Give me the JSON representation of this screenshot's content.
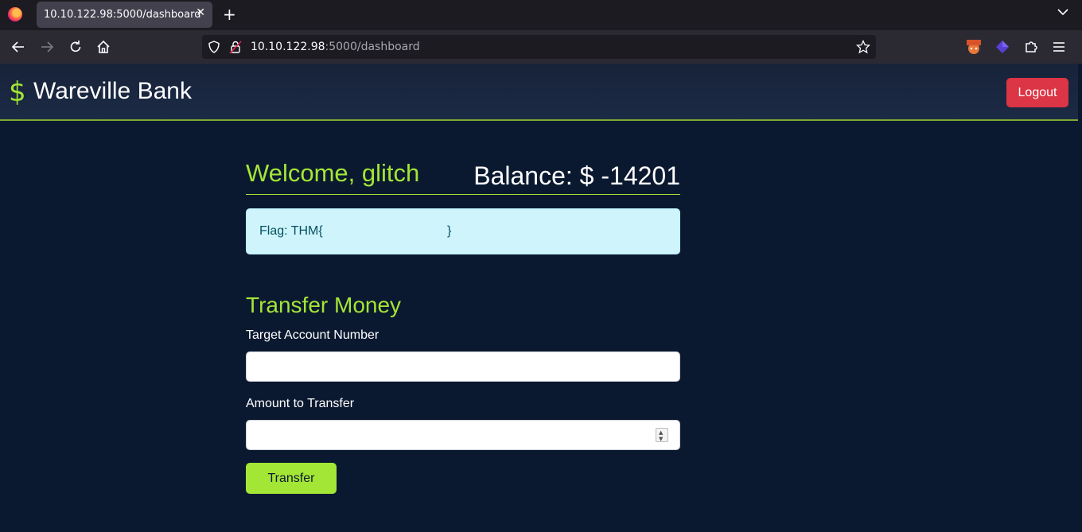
{
  "browser": {
    "tab_title": "10.10.122.98:5000/dashboard",
    "tab_close": "✕",
    "new_tab": "+",
    "url_host": "10.10.122.98",
    "url_path": ":5000/dashboard"
  },
  "header": {
    "brand_icon": "$",
    "brand_name": "Wareville Bank",
    "logout_label": "Logout"
  },
  "dashboard": {
    "welcome": "Welcome, glitch",
    "balance": "Balance: $ -14201",
    "flag_text": "Flag: THM{",
    "flag_close": "}"
  },
  "transfer": {
    "title": "Transfer Money",
    "account_label": "Target Account Number",
    "account_value": "",
    "amount_label": "Amount to Transfer",
    "amount_value": "",
    "submit_label": "Transfer"
  },
  "colors": {
    "accent": "#a3e635",
    "danger": "#dc3545",
    "background": "#0b1930",
    "alert_bg": "#cff4fc"
  }
}
